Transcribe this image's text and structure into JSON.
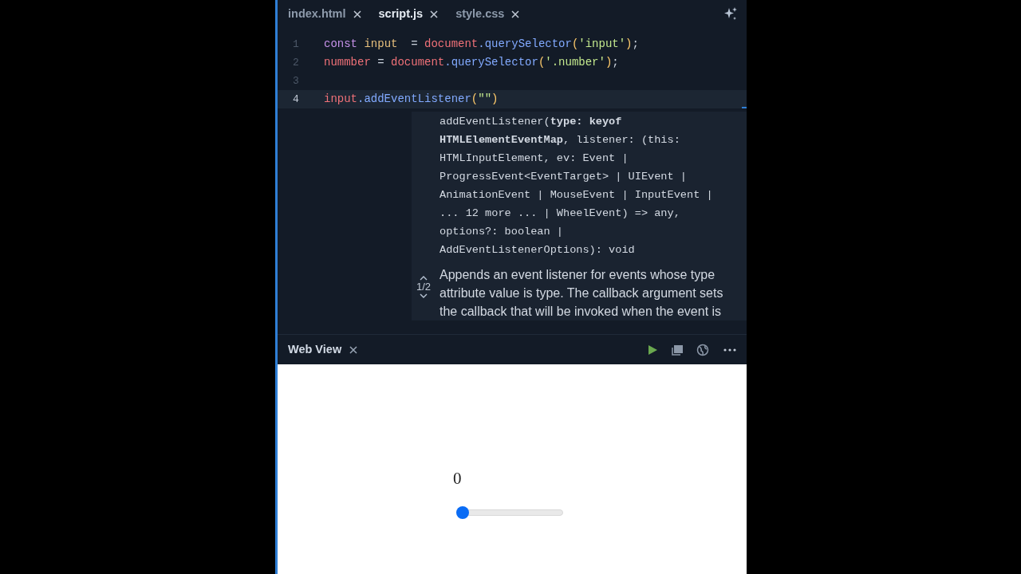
{
  "editor_tabs": [
    {
      "label": "index.html",
      "selected": false
    },
    {
      "label": "script.js",
      "selected": true
    },
    {
      "label": "style.css",
      "selected": false
    }
  ],
  "code_lines": [
    {
      "number": "1",
      "current": false,
      "tokens": [
        {
          "text": "const ",
          "kind": "keyword"
        },
        {
          "text": "input",
          "kind": "variable"
        },
        {
          "text": "  = ",
          "kind": "plain"
        },
        {
          "text": "document",
          "kind": "object"
        },
        {
          "text": ".querySelector",
          "kind": "method"
        },
        {
          "text": "(",
          "kind": "paren"
        },
        {
          "text": "'input'",
          "kind": "string"
        },
        {
          "text": ")",
          "kind": "paren"
        },
        {
          "text": ";",
          "kind": "plain"
        }
      ]
    },
    {
      "number": "2",
      "current": false,
      "tokens": [
        {
          "text": "nummber",
          "kind": "object"
        },
        {
          "text": " = ",
          "kind": "plain"
        },
        {
          "text": "document",
          "kind": "object"
        },
        {
          "text": ".querySelector",
          "kind": "method"
        },
        {
          "text": "(",
          "kind": "paren"
        },
        {
          "text": "'.number'",
          "kind": "string"
        },
        {
          "text": ")",
          "kind": "paren"
        },
        {
          "text": ";",
          "kind": "plain"
        }
      ]
    },
    {
      "number": "3",
      "current": false
    },
    {
      "number": "4",
      "current": true,
      "tokens": [
        {
          "text": "input",
          "kind": "object"
        },
        {
          "text": ".addEventListener",
          "kind": "method"
        },
        {
          "text": "(",
          "kind": "paren"
        },
        {
          "text": "\"\"",
          "kind": "string"
        },
        {
          "text": ")",
          "kind": "paren"
        }
      ]
    }
  ],
  "hover": {
    "signature_lines": [
      "addEventListener(**type: keyof**",
      "**HTMLElementEventMap**, listener: (this:",
      "HTMLInputElement, ev: Event |",
      "ProgressEvent<EventTarget> | UIEvent |",
      "AnimationEvent | MouseEvent | InputEvent |",
      "... 12 more ... | WheelEvent) => any,",
      "options?: boolean |",
      "AddEventListenerOptions): void"
    ],
    "description": "Appends an event listener for events whose type attribute value is type. The callback argument sets the callback that will be invoked when the event is",
    "overload_counter": "1/2"
  },
  "web_view": {
    "tab": "Web View",
    "number": "0",
    "slider": {
      "level": 0
    }
  }
}
